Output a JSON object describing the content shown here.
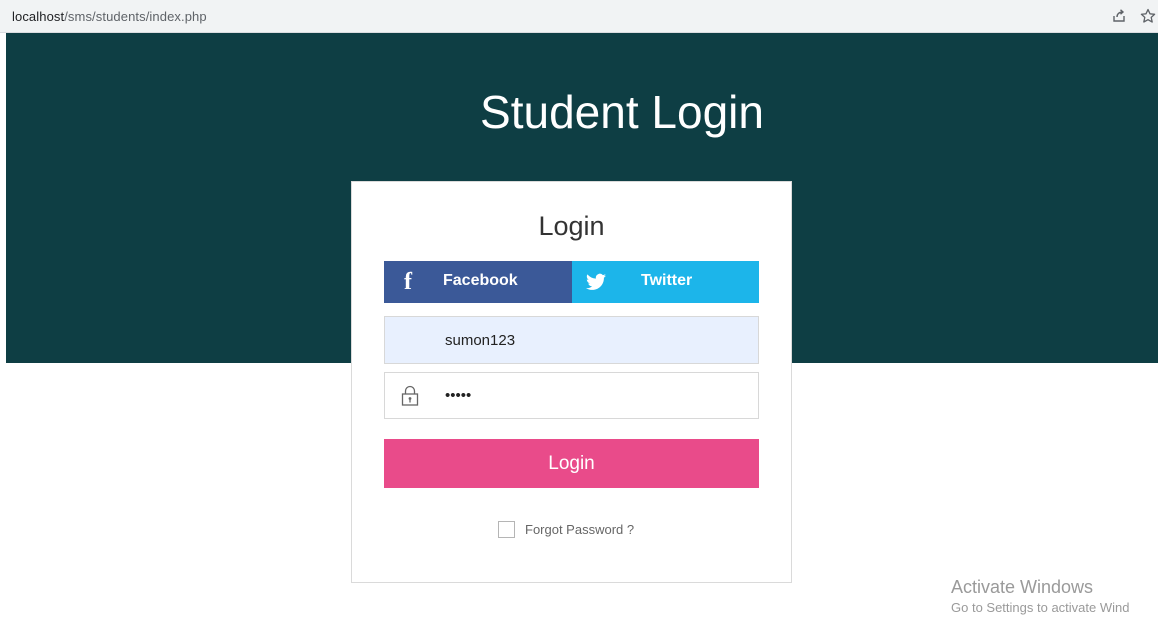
{
  "browser": {
    "url_host": "localhost",
    "url_path": "/sms/students/index.php",
    "icons": [
      "share-icon",
      "star-icon"
    ]
  },
  "banner": {
    "title": "Student Login",
    "color": "#0e3e44"
  },
  "login_card": {
    "title": "Login",
    "facebook_label": "Facebook",
    "twitter_label": "Twitter",
    "username_value": "sumon123",
    "password_value": "•••••",
    "login_button_label": "Login",
    "forgot_password_label": "Forgot Password ?",
    "colors": {
      "facebook": "#3b5998",
      "twitter": "#1cb5ea",
      "login_button": "#e94b8a"
    }
  },
  "watermark": {
    "line1": "Activate Windows",
    "line2": "Go to Settings to activate Wind"
  }
}
